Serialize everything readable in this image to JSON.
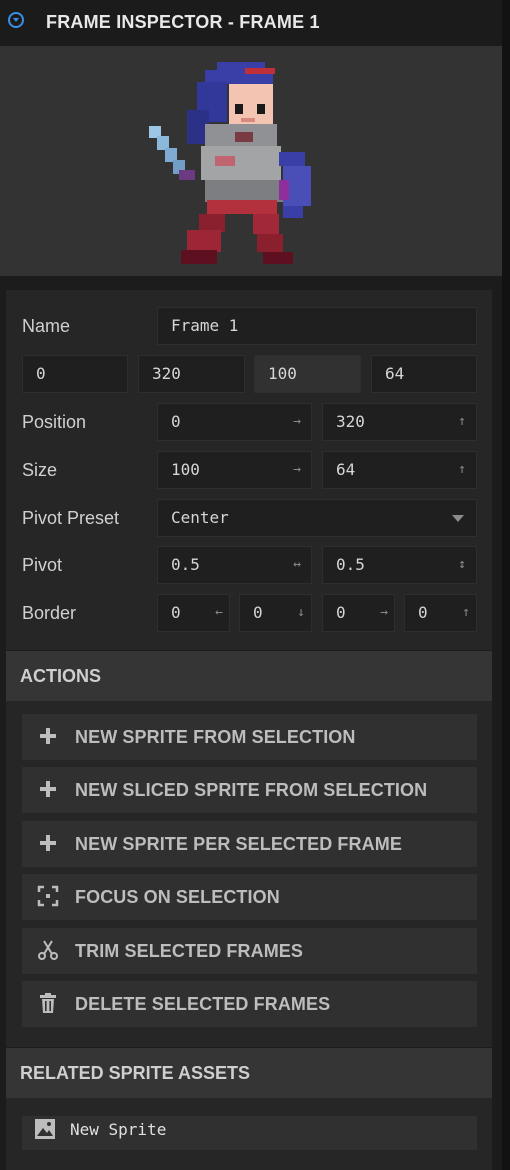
{
  "header": {
    "title": "FRAME INSPECTOR - FRAME 1"
  },
  "preview": {
    "alt": "knight-sprite-preview"
  },
  "inspector": {
    "name_label": "Name",
    "name_value": "Frame 1",
    "rect_values": [
      "0",
      "320",
      "100",
      "64"
    ],
    "position_label": "Position",
    "position_x": "0",
    "position_y": "320",
    "size_label": "Size",
    "size_w": "100",
    "size_h": "64",
    "pivot_preset_label": "Pivot Preset",
    "pivot_preset_value": "Center",
    "pivot_label": "Pivot",
    "pivot_x": "0.5",
    "pivot_y": "0.5",
    "border_label": "Border",
    "border_values": [
      "0",
      "0",
      "0",
      "0"
    ]
  },
  "actions": {
    "header": "ACTIONS",
    "items": [
      {
        "label": "NEW SPRITE FROM SELECTION",
        "icon": "plus-icon"
      },
      {
        "label": "NEW SLICED SPRITE FROM SELECTION",
        "icon": "plus-icon"
      },
      {
        "label": "NEW SPRITE PER SELECTED FRAME",
        "icon": "plus-icon"
      },
      {
        "label": "FOCUS ON SELECTION",
        "icon": "focus-icon"
      },
      {
        "label": "TRIM SELECTED FRAMES",
        "icon": "scissors-icon"
      },
      {
        "label": "DELETE SELECTED FRAMES",
        "icon": "trash-icon"
      }
    ]
  },
  "related": {
    "header": "RELATED SPRITE ASSETS",
    "items": [
      {
        "label": "New Sprite",
        "icon": "image-icon"
      }
    ]
  },
  "colors": {
    "accent": "#3b8ee8",
    "panel": "#262626",
    "field": "#1f1f1f"
  }
}
